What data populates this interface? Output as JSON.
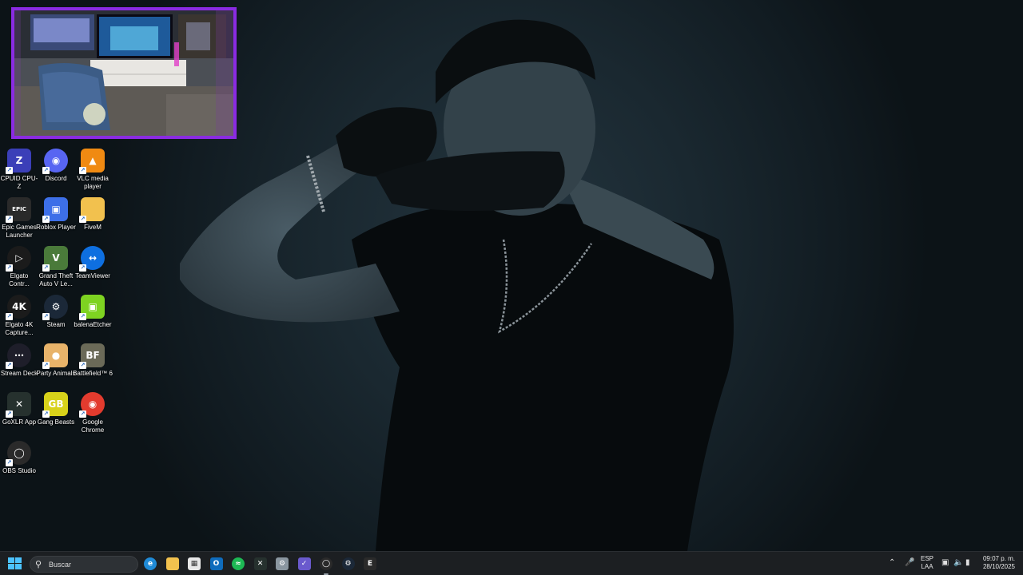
{
  "desktop": {
    "icons": [
      {
        "label": "CPUID CPU-Z",
        "icon": "cpuz-icon",
        "color": "#3b3fb8"
      },
      {
        "label": "Discord",
        "icon": "discord-icon",
        "color": "#5865f2"
      },
      {
        "label": "VLC media player",
        "icon": "vlc-icon",
        "color": "#f08a12"
      },
      {
        "label": "Epic Games Launcher",
        "icon": "epic-games-icon",
        "color": "#2a2a2a"
      },
      {
        "label": "Roblox Player",
        "icon": "roblox-icon",
        "color": "#3d6fe8"
      },
      {
        "label": "FiveM",
        "icon": "folder-icon",
        "color": "#f2c14e"
      },
      {
        "label": "Elgato Contr...",
        "icon": "elgato-control-icon",
        "color": "#1b1b1b"
      },
      {
        "label": "Grand Theft Auto V Le...",
        "icon": "gta-v-icon",
        "color": "#4a7a3a"
      },
      {
        "label": "TeamViewer",
        "icon": "teamviewer-icon",
        "color": "#0e6fe0"
      },
      {
        "label": "Elgato 4K Capture...",
        "icon": "elgato-4k-icon",
        "color": "#1b1b1b"
      },
      {
        "label": "Steam",
        "icon": "steam-icon",
        "color": "#1b2838"
      },
      {
        "label": "balenaEtcher",
        "icon": "balena-etcher-icon",
        "color": "#7ed321"
      },
      {
        "label": "Stream Deck",
        "icon": "stream-deck-icon",
        "color": "#1e1e2a"
      },
      {
        "label": "Party Animals",
        "icon": "party-animals-icon",
        "color": "#e8b36a"
      },
      {
        "label": "Battlefield™ 6",
        "icon": "battlefield-icon",
        "color": "#6b6a58"
      },
      {
        "label": "GoXLR App",
        "icon": "goxlr-icon",
        "color": "#26312e"
      },
      {
        "label": "Gang Beasts",
        "icon": "gang-beasts-icon",
        "color": "#d8d21a"
      },
      {
        "label": "Google Chrome",
        "icon": "chrome-icon",
        "color": "#e33b2e"
      },
      {
        "label": "OBS Studio",
        "icon": "obs-icon",
        "color": "#2a2a2a"
      }
    ]
  },
  "webcam": {
    "border_color": "#8a2be2"
  },
  "taskbar": {
    "search_placeholder": "Buscar",
    "apps": [
      {
        "icon": "edge-icon",
        "color": "#1f8ad6"
      },
      {
        "icon": "file-explorer-icon",
        "color": "#f2c14e"
      },
      {
        "icon": "microsoft-store-icon",
        "color": "#e8e8e8"
      },
      {
        "icon": "outlook-icon",
        "color": "#0f6cbd"
      },
      {
        "icon": "spotify-icon",
        "color": "#1db954"
      },
      {
        "icon": "goxlr-icon",
        "color": "#26312e"
      },
      {
        "icon": "settings-icon",
        "color": "#8a96a0"
      },
      {
        "icon": "snipping-tool-icon",
        "color": "#6a5acd"
      },
      {
        "icon": "obs-icon",
        "color": "#2a2a2a"
      },
      {
        "icon": "steam-icon",
        "color": "#1b2838"
      },
      {
        "icon": "epic-games-icon",
        "color": "#2a2a2a"
      }
    ],
    "language": {
      "line1": "ESP",
      "line2": "LAA"
    },
    "clock": {
      "time": "09:07 p. m.",
      "date": "28/10/2025"
    }
  }
}
